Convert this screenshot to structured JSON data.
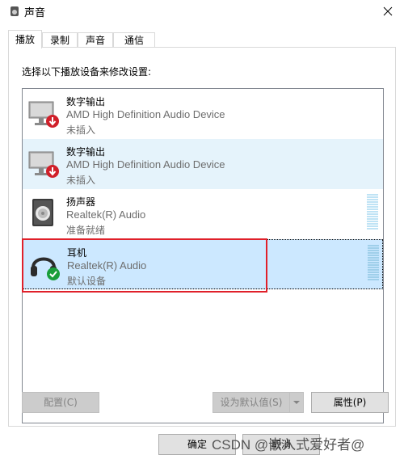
{
  "window": {
    "title": "声音"
  },
  "tabs": [
    {
      "label": "播放",
      "active": true
    },
    {
      "label": "录制",
      "active": false
    },
    {
      "label": "声音",
      "active": false
    },
    {
      "label": "通信",
      "active": false
    }
  ],
  "instruction": "选择以下播放设备来修改设置:",
  "devices": [
    {
      "name": "数字输出",
      "description": "AMD High Definition Audio Device",
      "status": "未插入",
      "icon": "monitor-speaker-icon",
      "badge": "unplugged-red-arrow"
    },
    {
      "name": "数字输出",
      "description": "AMD High Definition Audio Device",
      "status": "未插入",
      "icon": "monitor-speaker-icon",
      "badge": "unplugged-red-arrow"
    },
    {
      "name": "扬声器",
      "description": "Realtek(R) Audio",
      "status": "准备就绪",
      "icon": "speaker-icon",
      "badge": "none"
    },
    {
      "name": "耳机",
      "description": "Realtek(R) Audio",
      "status": "默认设备",
      "icon": "headphones-icon",
      "badge": "default-green-check",
      "selected": true
    }
  ],
  "buttons": {
    "configure": "配置(C)",
    "set_default": "设为默认值(S)",
    "properties": "属性(P)",
    "ok": "确定",
    "cancel": "取消"
  },
  "watermark": "CSDN @嵌入式爱好者@",
  "colors": {
    "selected_bg": "#cce8ff",
    "alt_bg": "#e5f3fb",
    "highlight_border": "#e0202a",
    "unplugged_badge": "#d0202a",
    "default_badge": "#1a9e3a"
  }
}
